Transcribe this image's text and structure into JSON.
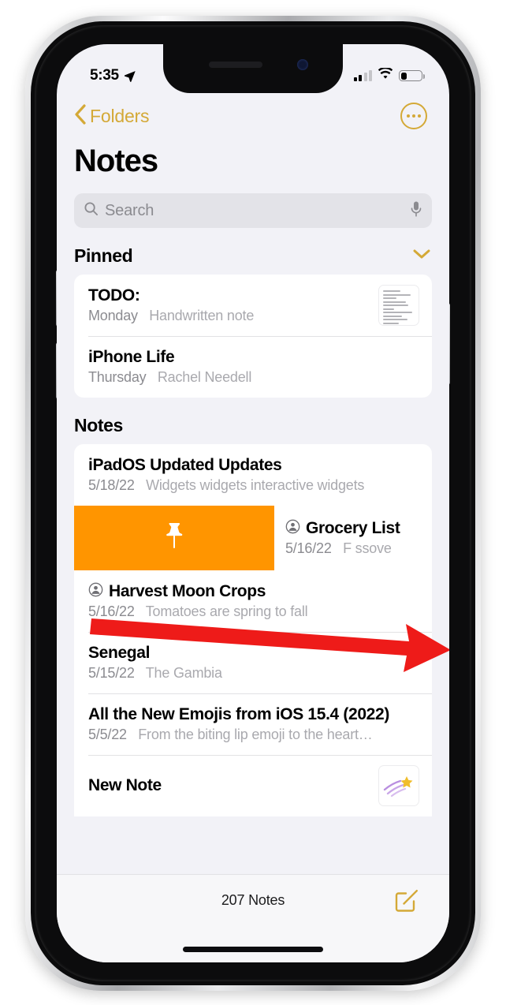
{
  "status_bar": {
    "time": "5:35",
    "location_icon": "location-arrow-icon",
    "cellular_icon": "cellular-bars-icon",
    "cellular_bars_filled": 2,
    "wifi_icon": "wifi-icon",
    "battery_icon": "battery-icon",
    "battery_level_percent": 25
  },
  "nav": {
    "back_label": "Folders",
    "back_icon": "chevron-left-icon",
    "more_icon": "ellipsis-circle-icon"
  },
  "header": {
    "title": "Notes"
  },
  "search": {
    "placeholder": "Search",
    "value": "",
    "search_icon": "magnifier-icon",
    "mic_icon": "microphone-icon"
  },
  "sections": [
    {
      "title": "Pinned",
      "collapse_icon": "chevron-down-icon",
      "notes": [
        {
          "title": "TODO:",
          "date": "Monday",
          "snippet": "Handwritten note",
          "shared": false,
          "thumbnail": "handwritten-note-thumbnail"
        },
        {
          "title": "iPhone Life",
          "date": "Thursday",
          "snippet": "Rachel Needell",
          "shared": false,
          "thumbnail": null
        }
      ]
    },
    {
      "title": "Notes",
      "collapse_icon": null,
      "notes": [
        {
          "title": "iPadOS Updated Updates",
          "date": "5/18/22",
          "snippet": "Widgets widgets interactive widgets",
          "shared": false,
          "thumbnail": null
        },
        {
          "title": "Grocery List",
          "date": "5/16/22",
          "snippet": "F           ssove",
          "shared": true,
          "thumbnail": null,
          "swiped": true,
          "swipe_action_label": "",
          "swipe_action_icon": "pin-icon",
          "swipe_action_color": "#ff9500"
        },
        {
          "title": "Harvest Moon Crops",
          "date": "5/16/22",
          "snippet": "Tomatoes are spring to fall",
          "shared": true,
          "thumbnail": null
        },
        {
          "title": "Senegal",
          "date": "5/15/22",
          "snippet": "The Gambia",
          "shared": false,
          "thumbnail": null
        },
        {
          "title": "All the New Emojis from iOS 15.4 (2022)",
          "date": "5/5/22",
          "snippet": "From the biting lip emoji to the heart…",
          "shared": false,
          "thumbnail": null
        },
        {
          "title": "New Note",
          "date": "",
          "snippet": "",
          "shared": false,
          "thumbnail": "shooting-star-thumbnail"
        }
      ]
    }
  ],
  "toolbar": {
    "count_label": "207 Notes",
    "compose_icon": "compose-note-icon"
  },
  "annotation": {
    "arrow_icon": "red-arrow-annotation",
    "color": "#ee1b19"
  },
  "colors": {
    "accent": "#d4a937",
    "swipe_pin": "#ff9500",
    "background": "#f2f2f7",
    "card": "#ffffff",
    "annotation_red": "#ee1b19"
  }
}
